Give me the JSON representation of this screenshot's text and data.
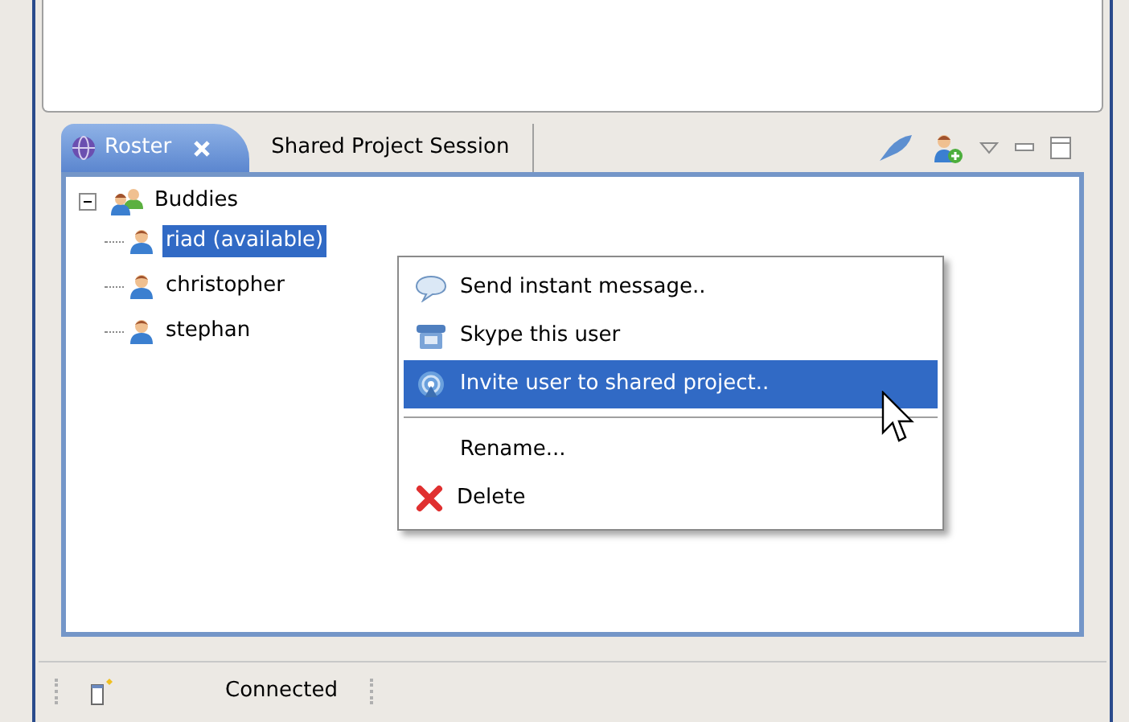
{
  "tabs": [
    {
      "label": "Roster",
      "selected": true,
      "closable": true
    },
    {
      "label": "Shared Project Session",
      "selected": false,
      "closable": false
    }
  ],
  "tree": [
    {
      "label": "Buddies",
      "kind": "group",
      "expanded": true,
      "selected": false,
      "children": [
        {
          "label": "riad (available)",
          "kind": "user",
          "selected": true
        },
        {
          "label": "christopher",
          "kind": "user",
          "selected": false
        },
        {
          "label": "stephan",
          "kind": "user",
          "selected": false
        }
      ]
    }
  ],
  "context_menu": [
    {
      "label": "Send instant message..",
      "kind": "chat",
      "selected": false
    },
    {
      "label": "Skype this user",
      "kind": "phone",
      "selected": false
    },
    {
      "label": "Invite user to shared project..",
      "kind": "invite",
      "selected": true
    },
    {
      "kind": "separator"
    },
    {
      "label": "Rename...",
      "kind": "plain",
      "selected": false
    },
    {
      "label": "Delete",
      "kind": "delete",
      "selected": false
    }
  ],
  "status_bar": {
    "text": "Connected"
  }
}
